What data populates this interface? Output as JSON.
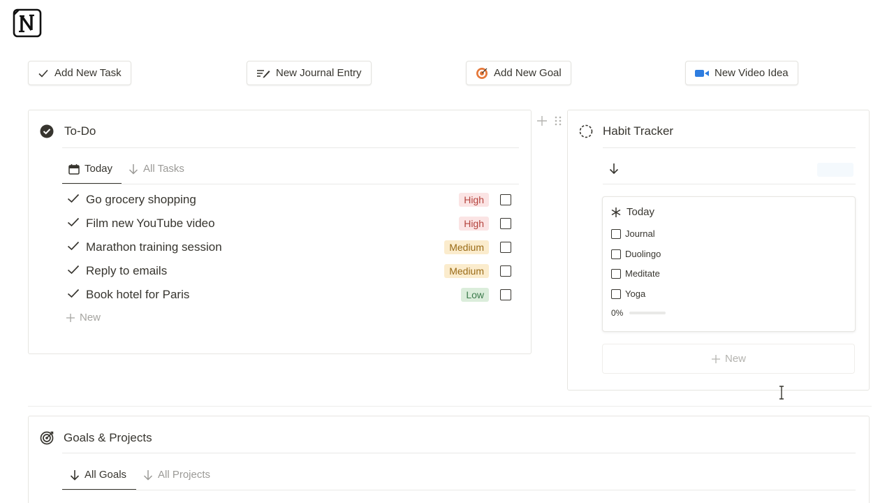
{
  "colors": {
    "high_bg": "#fbe4e4",
    "high_text": "#b4433d",
    "medium_bg": "#fbeccd",
    "medium_text": "#9a6b17",
    "low_bg": "#dbeddb",
    "low_text": "#3b7a4b",
    "video_blue": "#2e7de0",
    "goal_orange": "#e5783a"
  },
  "actions": {
    "add_task": "Add New Task",
    "journal": "New Journal Entry",
    "goal": "Add New Goal",
    "video": "New Video Idea"
  },
  "todo": {
    "title": "To-Do",
    "tabs": [
      "Today",
      "All Tasks"
    ],
    "tasks": [
      {
        "name": "Go grocery shopping",
        "priority": "High"
      },
      {
        "name": "Film new YouTube video",
        "priority": "High"
      },
      {
        "name": "Marathon training session",
        "priority": "Medium"
      },
      {
        "name": "Reply to emails",
        "priority": "Medium"
      },
      {
        "name": "Book hotel for Paris",
        "priority": "Low"
      }
    ],
    "new_label": "New"
  },
  "habit": {
    "title": "Habit Tracker",
    "card_title": "Today",
    "items": [
      "Journal",
      "Duolingo",
      "Meditate",
      "Yoga"
    ],
    "progress_label": "0%",
    "progress": 0,
    "new_label": "New"
  },
  "goals": {
    "title": "Goals & Projects",
    "tabs": [
      "All Goals",
      "All Projects"
    ]
  }
}
